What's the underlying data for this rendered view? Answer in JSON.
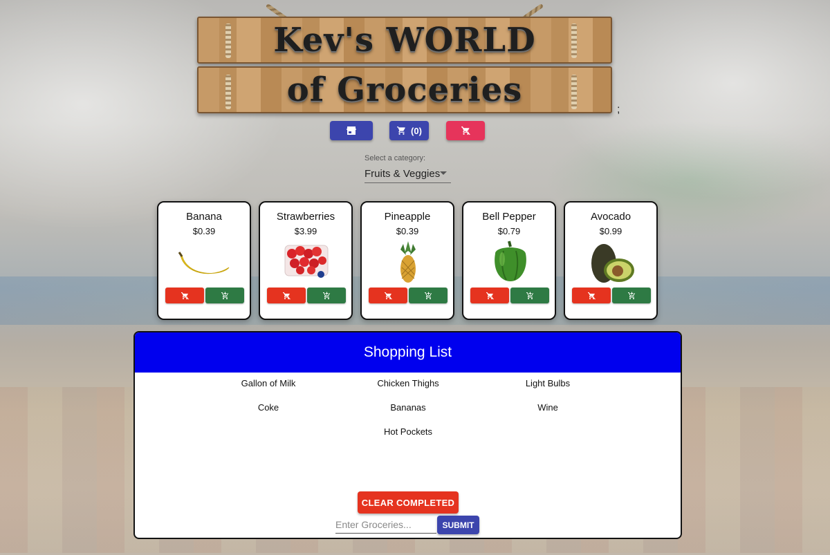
{
  "header": {
    "sign_line1": "Kev's WORLD",
    "sign_line2": "of Groceries",
    "trailing_text": ";"
  },
  "nav": {
    "store_icon": "store-icon",
    "cart_icon": "cart-icon",
    "cart_count": "(0)",
    "remove_cart_icon": "remove-shopping-cart-icon"
  },
  "category": {
    "label": "Select a category:",
    "selected": "Fruits & Veggies"
  },
  "products": [
    {
      "name": "Banana",
      "price": "$0.39"
    },
    {
      "name": "Strawberries",
      "price": "$3.99"
    },
    {
      "name": "Pineapple",
      "price": "$0.39"
    },
    {
      "name": "Bell Pepper",
      "price": "$0.79"
    },
    {
      "name": "Avocado",
      "price": "$0.99"
    }
  ],
  "shopping_list": {
    "title": "Shopping List",
    "items": [
      "Gallon of Milk",
      "Chicken Thighs",
      "Light Bulbs",
      "Coke",
      "Bananas",
      "Wine",
      "Hot Pockets"
    ],
    "clear_completed_label": "CLEAR COMPLETED",
    "input_placeholder": "Enter Groceries...",
    "submit_label": "SUBMIT"
  },
  "colors": {
    "primary": "#3c45ad",
    "danger": "#e5331f",
    "pink": "#e6345b",
    "add_green": "#2e7a44",
    "list_header": "#0000ee"
  }
}
